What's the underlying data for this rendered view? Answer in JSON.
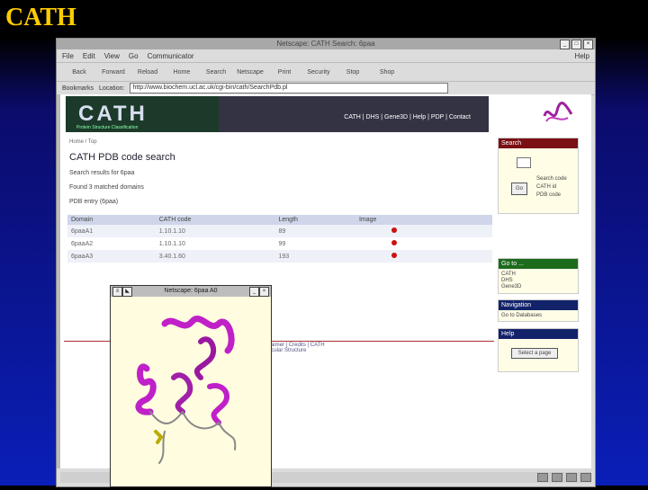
{
  "slide": {
    "title": "CATH"
  },
  "browser": {
    "title": "Netscape: CATH Search: 6paa",
    "menu": [
      "File",
      "Edit",
      "View",
      "Go",
      "Communicator"
    ],
    "help": "Help",
    "toolbar": [
      "Back",
      "Forward",
      "Reload",
      "Home",
      "Search",
      "Netscape",
      "Print",
      "Security",
      "Stop",
      "Shop"
    ],
    "bookmarks": "Bookmarks",
    "location_label": "Location:",
    "location_value": "http://www.biochem.ucl.ac.uk/cgi-bin/cath/SearchPdb.pl"
  },
  "page": {
    "banner_logo": "CATH",
    "banner_sub": "Protein Structure Classification",
    "banner_nav": "CATH | DHS | Gene3D | Help | PDP | Contact",
    "breadcrumb": "Home / Top",
    "heading": "CATH PDB code search",
    "line1": "Search results for 6paa",
    "line2": "Found 3 matched domains",
    "line3": "PDB entry (6paa)",
    "table": {
      "headers": [
        "Domain",
        "CATH code",
        "Length",
        "Image"
      ],
      "rows": [
        [
          "6paaA1",
          "1.10.1.10",
          "89",
          ""
        ],
        [
          "6paaA2",
          "1.10.1.10",
          "99",
          ""
        ],
        [
          "6paaA3",
          "3.40.1.60",
          "193",
          ""
        ]
      ]
    },
    "sidebar": {
      "search": {
        "title": "Search",
        "button": "Go",
        "options": [
          "Search code",
          "CATH id",
          "PDB code"
        ]
      },
      "goto": {
        "title": "Go to ...",
        "items": [
          "CATH",
          "DHS",
          "Gene3D"
        ]
      },
      "navigation": {
        "title": "Navigation",
        "items": [
          "Go to Databases"
        ]
      },
      "help": {
        "title": "Help",
        "button": "Select a page"
      }
    },
    "footer_links": "Contacts | Disclaimer | Credits | CATH",
    "footer_note": "Biomolecular Structure"
  },
  "popup": {
    "title": "Netscape: 6paa A0"
  },
  "colors": {
    "title": "#ffcc00",
    "background_top": "#000000",
    "background_bottom": "#0a1fb8",
    "ribbon": "#c020c8",
    "heading_red": "#7a0f14",
    "heading_green": "#1d6b1d",
    "heading_navy": "#13236a"
  }
}
